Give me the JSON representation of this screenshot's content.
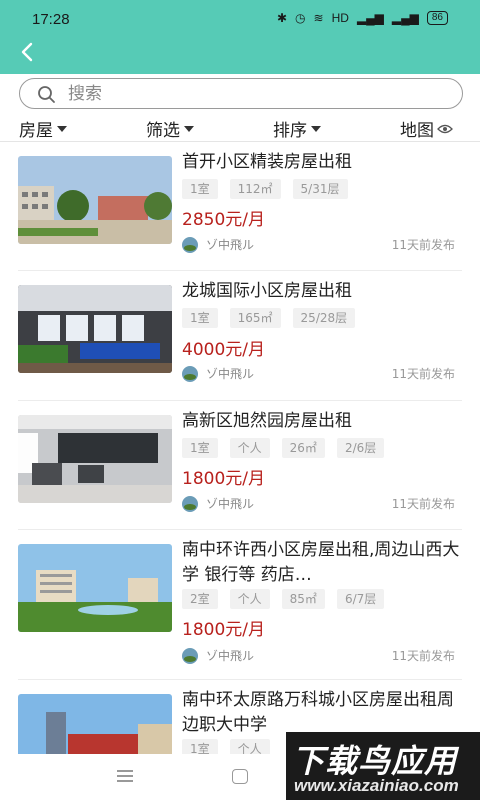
{
  "status_bar": {
    "time": "17:28",
    "network": "HD",
    "battery": "86"
  },
  "search": {
    "placeholder": "搜索"
  },
  "filters": {
    "type": "房屋",
    "filter": "筛选",
    "sort": "排序",
    "map": "地图"
  },
  "listings": [
    {
      "title": "首开小区精装房屋出租",
      "tags": [
        "1室",
        "112㎡",
        "5/31层"
      ],
      "price": "2850元/月",
      "user": "ゾ中飛ル",
      "posted": "11天前发布"
    },
    {
      "title": "龙城国际小区房屋出租",
      "tags": [
        "1室",
        "165㎡",
        "25/28层"
      ],
      "price": "4000元/月",
      "user": "ゾ中飛ル",
      "posted": "11天前发布"
    },
    {
      "title": "高新区旭然园房屋出租",
      "tags": [
        "1室",
        "个人",
        "26㎡",
        "2/6层"
      ],
      "price": "1800元/月",
      "user": "ゾ中飛ル",
      "posted": "11天前发布"
    },
    {
      "title": "南中环许西小区房屋出租,周边山西大学 银行等 药店…",
      "tags": [
        "2室",
        "个人",
        "85㎡",
        "6/7层"
      ],
      "price": "1800元/月",
      "user": "ゾ中飛ル",
      "posted": "11天前发布"
    },
    {
      "title": "南中环太原路万科城小区房屋出租周边职大中学",
      "tags": [
        "1室",
        "个人"
      ],
      "price": "",
      "user": "",
      "posted": ""
    }
  ],
  "watermark": {
    "brand": "下载鸟应用",
    "url": "www.xiazainiao.com"
  },
  "colors": {
    "accent": "#56cbb6",
    "price": "#b8211d",
    "tag_bg": "#f1f1f1"
  }
}
